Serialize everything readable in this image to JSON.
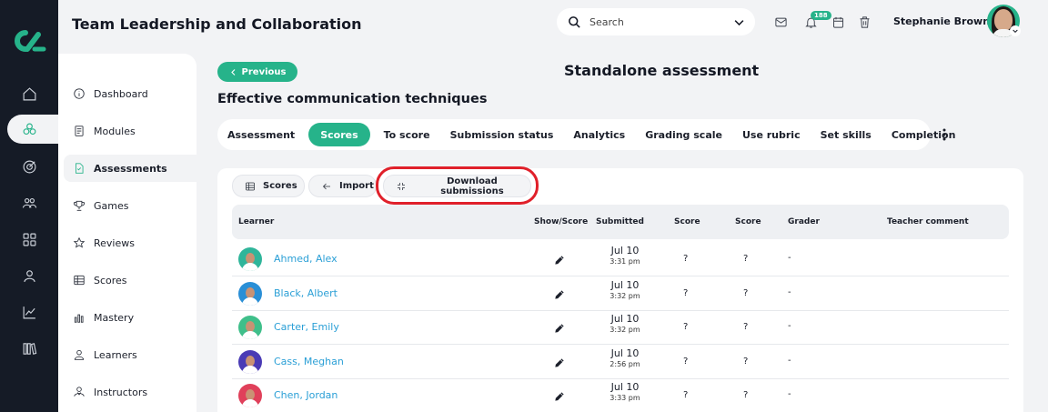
{
  "header": {
    "course_title": "Team Leadership and Collaboration",
    "search_placeholder": "Search",
    "notification_count": "188",
    "user_name": "Stephanie Brown"
  },
  "rail": {
    "icons": [
      "home-icon",
      "courses-icon",
      "target-icon",
      "people-icon",
      "apps-icon",
      "user-icon",
      "chart-icon",
      "library-icon"
    ],
    "accent": "#26b38a"
  },
  "sidebar": {
    "items": [
      {
        "label": "Dashboard",
        "icon": "info-icon"
      },
      {
        "label": "Modules",
        "icon": "book-icon"
      },
      {
        "label": "Assessments",
        "icon": "document-icon",
        "active": true
      },
      {
        "label": "Games",
        "icon": "trophy-icon"
      },
      {
        "label": "Reviews",
        "icon": "star-icon"
      },
      {
        "label": "Scores",
        "icon": "table-icon"
      },
      {
        "label": "Mastery",
        "icon": "bars-icon"
      },
      {
        "label": "Learners",
        "icon": "learner-icon"
      },
      {
        "label": "Instructors",
        "icon": "instructor-icon"
      }
    ]
  },
  "main": {
    "previous_label": "Previous",
    "page_title": "Standalone assessment",
    "assessment_name": "Effective communication techniques",
    "tabs": [
      "Assessment",
      "Scores",
      "To score",
      "Submission status",
      "Analytics",
      "Grading scale",
      "Use rubric",
      "Set skills",
      "Completion"
    ],
    "active_tab": "Scores",
    "toolbar": {
      "scores_label": "Scores",
      "import_label": "Import",
      "download_label": "Download submissions"
    },
    "table": {
      "headers": {
        "learner": "Learner",
        "show_score": "Show/Score",
        "submitted": "Submitted",
        "score1": "Score",
        "score2": "Score",
        "grader": "Grader",
        "teacher_comment": "Teacher comment"
      },
      "rows": [
        {
          "name": "Ahmed, Alex",
          "date": "Jul 10",
          "time": "3:31 pm",
          "score1": "?",
          "score2": "?",
          "grader": "-",
          "avatar_color": "#2fb59a"
        },
        {
          "name": "Black, Albert",
          "date": "Jul 10",
          "time": "3:32 pm",
          "score1": "?",
          "score2": "?",
          "grader": "-",
          "avatar_color": "#2a8fd6"
        },
        {
          "name": "Carter, Emily",
          "date": "Jul 10",
          "time": "3:32 pm",
          "score1": "?",
          "score2": "?",
          "grader": "-",
          "avatar_color": "#3fbf8a"
        },
        {
          "name": "Cass, Meghan",
          "date": "Jul 10",
          "time": "2:56 pm",
          "score1": "?",
          "score2": "?",
          "grader": "-",
          "avatar_color": "#4a3bb5"
        },
        {
          "name": "Chen, Jordan",
          "date": "Jul 10",
          "time": "3:33 pm",
          "score1": "?",
          "score2": "?",
          "grader": "-",
          "avatar_color": "#e0405a"
        }
      ]
    }
  }
}
